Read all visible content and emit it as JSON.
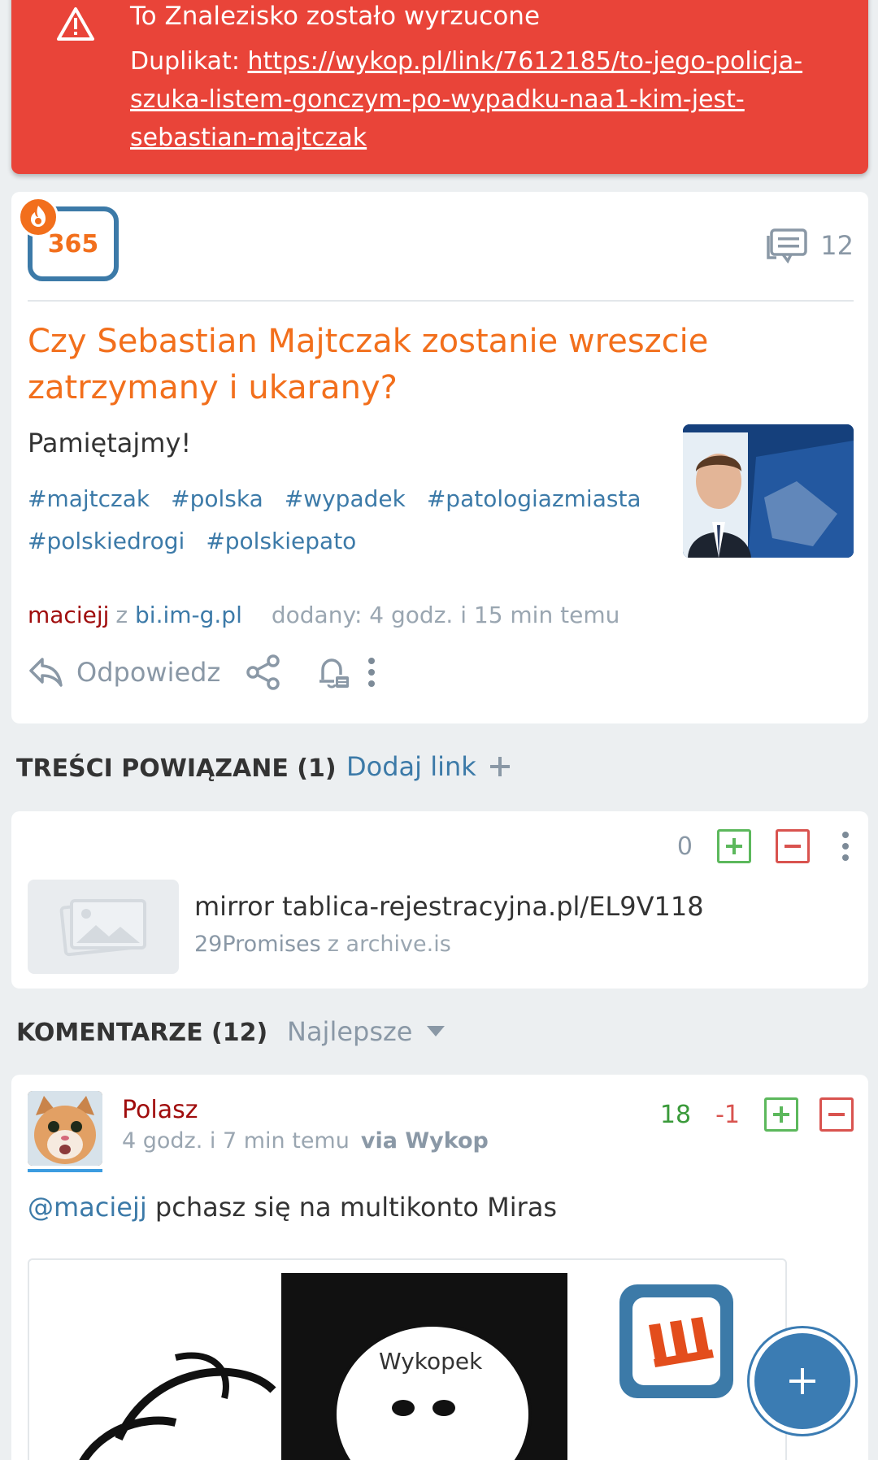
{
  "alert": {
    "title": "To Znalezisko zostało wyrzucone",
    "duplicate_prefix": "Duplikat: ",
    "duplicate_link": "https://wykop.pl/link/7612185/to-jego-policja-szuka-listem-gonczym-po-wypadku-naa1-kim-jest-sebastian-majtczak",
    "color": "#e94439"
  },
  "post": {
    "votes": "365",
    "comments_count": "12",
    "title": "Czy Sebastian Majtczak zostanie wreszcie zatrzymany i ukarany?",
    "description": "Pamiętajmy!",
    "tags": [
      "#majtczak",
      "#polska",
      "#wypadek",
      "#patologiazmiasta",
      "#polskiedrogi",
      "#polskiepato"
    ],
    "author": "maciejj",
    "from_word": "z",
    "source": "bi.im-g.pl",
    "added": "dodany: 4 godz. i 15 min temu",
    "reply_label": "Odpowiedz",
    "accent_color": "#f26f1c"
  },
  "related": {
    "heading": "TREŚCI POWIĄZANE (1)",
    "add_link_label": "Dodaj link",
    "item": {
      "score": "0",
      "title": "mirror tablica-rejestracyjna.pl/EL9V118",
      "author": "29Promises",
      "from_word": "z",
      "source": "archive.is"
    }
  },
  "comments": {
    "heading": "KOMENTARZE (12)",
    "sort_label": "Najlepsze",
    "first": {
      "author": "Polasz",
      "time": "4 godz. i 7 min temu",
      "via": "via Wykop",
      "up": "18",
      "down": "-1",
      "mention": "@maciejj",
      "text": " pchasz się na multikonto Miras",
      "image_caption": "Wykopek"
    }
  }
}
